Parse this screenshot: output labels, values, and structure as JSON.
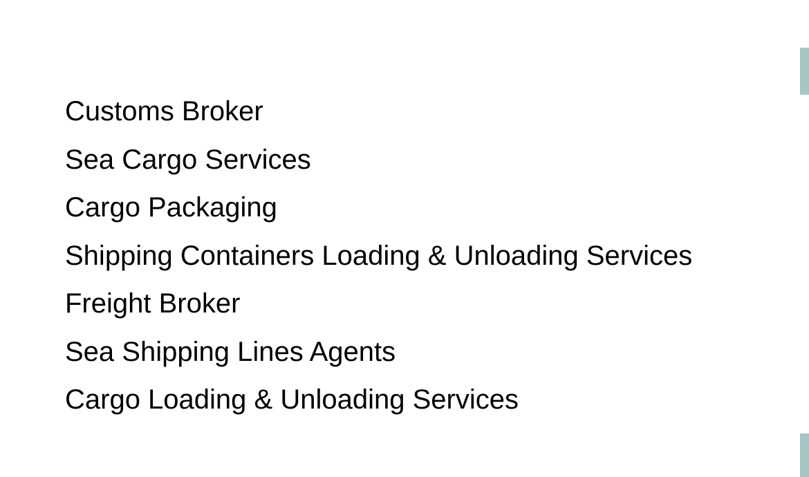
{
  "services": {
    "items": [
      {
        "label": "Customs Broker"
      },
      {
        "label": "Sea Cargo Services"
      },
      {
        "label": "Cargo Packaging"
      },
      {
        "label": "Shipping Containers Loading & Unloading Services"
      },
      {
        "label": "Freight Broker"
      },
      {
        "label": "Sea Shipping Lines Agents"
      },
      {
        "label": "Cargo Loading & Unloading Services"
      }
    ]
  },
  "colors": {
    "background": "#ffffff",
    "text": "#000000",
    "edge_accent": "#a6c6c6"
  }
}
